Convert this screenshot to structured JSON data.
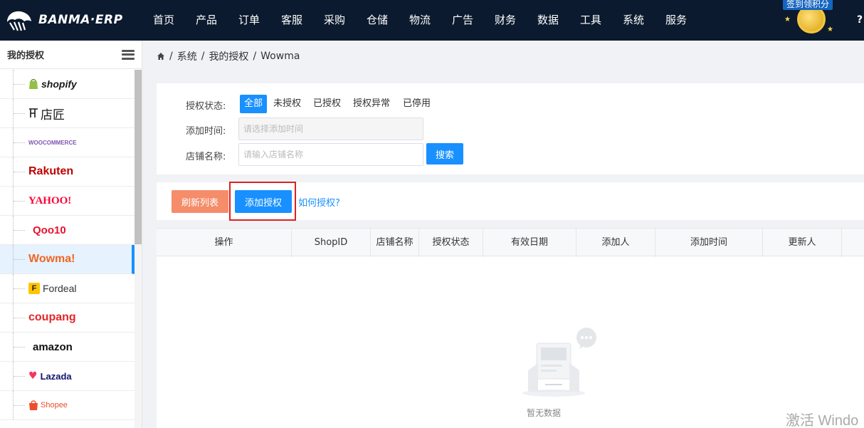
{
  "app": {
    "logo_text": "BANMA·ERP"
  },
  "nav": {
    "items": [
      "首页",
      "产品",
      "订单",
      "客服",
      "采购",
      "仓储",
      "物流",
      "广告",
      "财务",
      "数据",
      "工具",
      "系统",
      "服务"
    ]
  },
  "checkin": {
    "label": "签到领积分"
  },
  "help": {
    "label": "?"
  },
  "sidebar": {
    "title": "我的授权",
    "items": [
      {
        "label": "shopify",
        "color": "#1a1a1a"
      },
      {
        "label": "店匠",
        "color": "#1a1a1a"
      },
      {
        "label": "WOOCOMMERCE",
        "color": "#7f54b3"
      },
      {
        "label": "Rakuten",
        "color": "#bf0000"
      },
      {
        "label": "YAHOO!",
        "color": "#ff0033"
      },
      {
        "label": "Qoo10",
        "color": "#e8112d"
      },
      {
        "label": "Wowma!",
        "color": "#f26522"
      },
      {
        "label": "Fordeal",
        "color": "#333333"
      },
      {
        "label": "coupang",
        "color": "#e52528"
      },
      {
        "label": "amazon",
        "color": "#111111"
      },
      {
        "label": "Lazada",
        "color": "#0f146d"
      },
      {
        "label": "Shopee",
        "color": "#ee4d2d"
      }
    ],
    "active_index": 6
  },
  "breadcrumb": {
    "system": "系统",
    "auth": "我的授权",
    "current": "Wowma",
    "sep": "/"
  },
  "filters": {
    "status_label": "授权状态:",
    "status_options": [
      "全部",
      "未授权",
      "已授权",
      "授权异常",
      "已停用"
    ],
    "status_selected": "全部",
    "time_label": "添加时间:",
    "time_placeholder": "请选择添加时间",
    "shop_label": "店铺名称:",
    "shop_placeholder": "请输入店铺名称",
    "search_label": "搜索"
  },
  "actions": {
    "refresh_label": "刷新列表",
    "add_label": "添加授权",
    "how_label": "如何授权?"
  },
  "table": {
    "columns": [
      "操作",
      "ShopID",
      "店铺名称",
      "授权状态",
      "有效日期",
      "添加人",
      "添加时间",
      "更新人"
    ],
    "empty_text": "暂无数据"
  },
  "watermark": "激活 Windo"
}
